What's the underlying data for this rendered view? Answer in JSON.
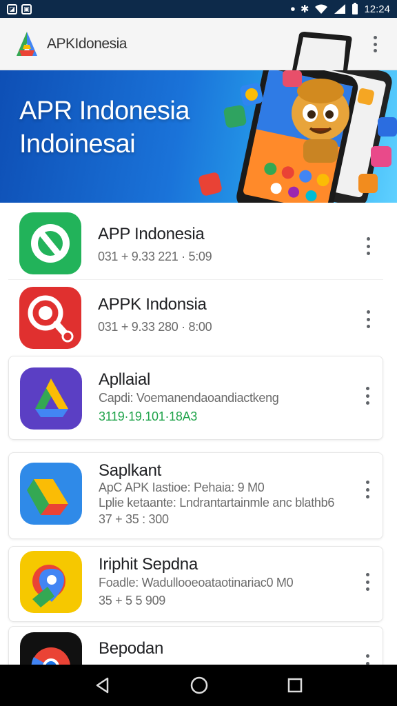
{
  "status_bar": {
    "time": "12:24"
  },
  "app_bar": {
    "title": "APKIdonesia"
  },
  "banner": {
    "line1": "APR Indonesia",
    "line2": "Indoinesai"
  },
  "apps": [
    {
      "name": "APP Indonesia",
      "line1": "031 + 9.33 221 · 5:09",
      "line2": "",
      "line3": ""
    },
    {
      "name": "APPK Indonsia",
      "line1": "031 + 9.33 280 · 8:00",
      "line2": "",
      "line3": ""
    },
    {
      "name": "Apllaial",
      "line1": "Capdi: Voemanendaoandiactkeng",
      "line2": "3119·19.101·18A3",
      "line3": ""
    },
    {
      "name": "Saplkant",
      "line1": "ApC APK Iastioe: Pehaia: 9 M0",
      "line2": "Lplie ketaante: Lndrantartainmle anc blathb6",
      "line3": "37 + 35 : 300"
    },
    {
      "name": "Iriphit Sepdna",
      "line1": "Foadle: Wadullooeoataotinariac0 M0",
      "line2": "35 + 5 5 909",
      "line3": ""
    },
    {
      "name": "Bepodan",
      "line1": "",
      "line2": "",
      "line3": ""
    }
  ],
  "colors": {
    "status_bar": "#0d2a4a",
    "app_bar": "#f5f5f5",
    "banner_start": "#0e4fb5",
    "banner_end": "#5fd0ff",
    "accent_green": "#1fa34a"
  }
}
